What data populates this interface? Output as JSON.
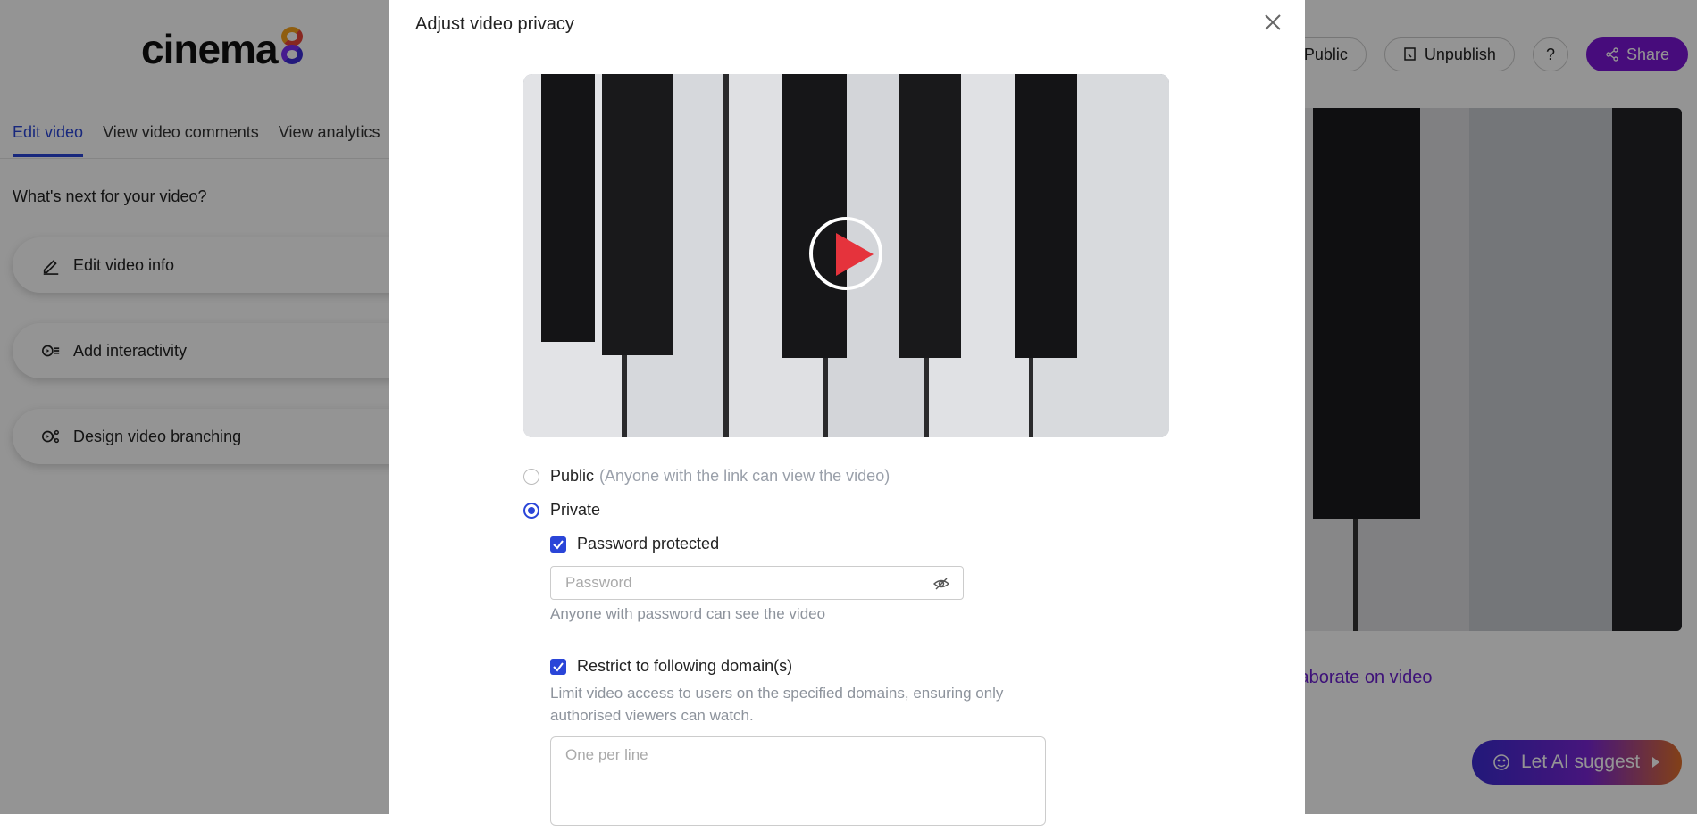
{
  "app": {
    "logo_text": "cinema",
    "tabs": [
      {
        "label": "Edit video"
      },
      {
        "label": "View video comments"
      },
      {
        "label": "View analytics"
      }
    ],
    "next_title": "What's next for your video?",
    "actions": [
      {
        "label": "Edit video info",
        "icon": "pencil-icon"
      },
      {
        "label": "Add interactivity",
        "icon": "interactivity-icon"
      },
      {
        "label": "Design video branching",
        "icon": "branching-icon"
      }
    ],
    "header": {
      "public_label": "Public",
      "unpublish_label": "Unpublish",
      "help_label": "?",
      "share_label": "Share"
    },
    "collab_label": "Collaborate on video",
    "ai_label": "Let AI suggest",
    "accent": "#7b16d6",
    "primary_blue": "#2a45d8"
  },
  "modal": {
    "title": "Adjust video privacy",
    "public_label": "Public",
    "public_hint": "(Anyone with the link can view the video)",
    "private_label": "Private",
    "selected": "private",
    "password_protected": {
      "label": "Password protected",
      "checked": true
    },
    "password": {
      "value": "",
      "placeholder": "Password",
      "helper": "Anyone with password can see the video"
    },
    "restrict_domains": {
      "label": "Restrict to following domain(s)",
      "checked": true
    },
    "domains": {
      "helper_line1": "Limit video access to users on the specified domains, ensuring only",
      "helper_line2": "authorised viewers can watch.",
      "placeholder": "One per line"
    }
  }
}
